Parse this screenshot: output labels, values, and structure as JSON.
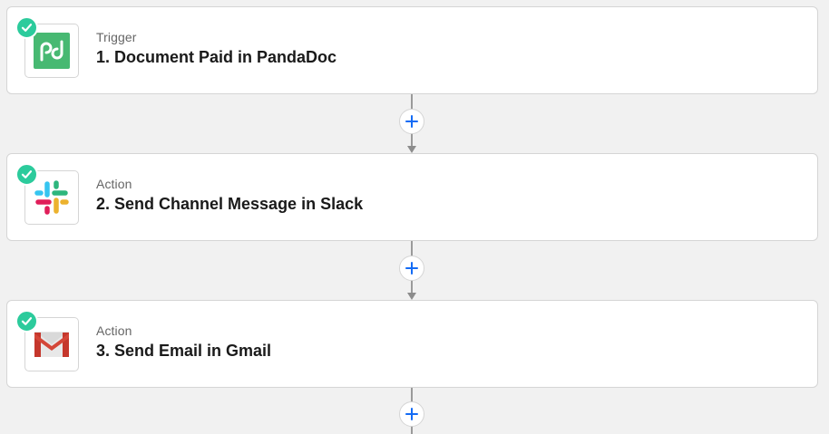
{
  "steps": [
    {
      "kind": "Trigger",
      "title": "1. Document Paid in PandaDoc",
      "app": "pandadoc",
      "icon": "pandadoc-logo-icon",
      "status": "complete"
    },
    {
      "kind": "Action",
      "title": "2. Send Channel Message in Slack",
      "app": "slack",
      "icon": "slack-logo-icon",
      "status": "complete"
    },
    {
      "kind": "Action",
      "title": "3. Send Email in Gmail",
      "app": "gmail",
      "icon": "gmail-logo-icon",
      "status": "complete"
    }
  ],
  "colors": {
    "background": "#f1f1f1",
    "card": "#ffffff",
    "check": "#2ccb9c",
    "add_icon": "#136bf5",
    "connector": "#9a9a9a",
    "pandadoc": "#47b972"
  }
}
